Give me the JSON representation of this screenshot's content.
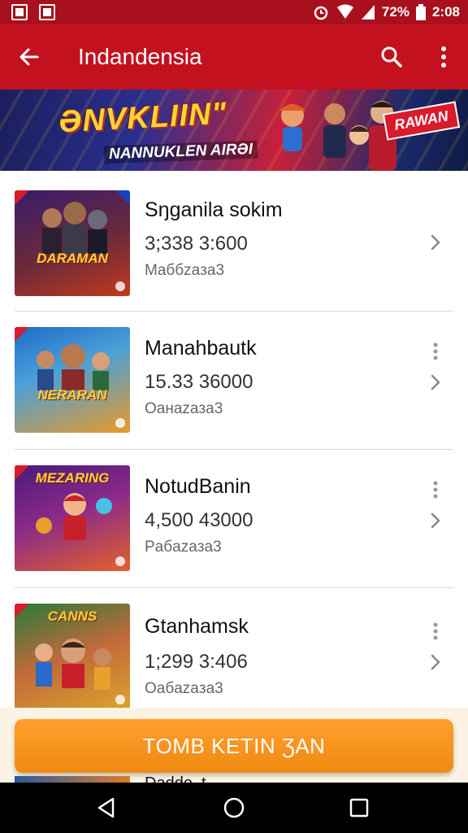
{
  "status_bar": {
    "battery_text": "72%",
    "time": "2:08",
    "icons": [
      "image-icon",
      "notification-icon",
      "alarm-icon",
      "wifi-icon",
      "signal-icon",
      "battery-icon"
    ]
  },
  "app_bar": {
    "title": "Indandensia",
    "back_icon": "arrow-left-icon",
    "search_icon": "search-icon",
    "menu_icon": "more-vert-icon",
    "color": "#c4111f"
  },
  "banner": {
    "title": "ƏNVKLIIN\"",
    "subtitle": "NANNUKLEN AIRƏI",
    "badge": "RAWAN"
  },
  "items": [
    {
      "title": "Sŋganila sokim",
      "numbers": "3;338  3:600",
      "subtitle": "Maббzaза3",
      "thumb_title": "DARAMAN",
      "thumb_colors": [
        "#3a1c6a",
        "#c23a1e"
      ],
      "kebab": false
    },
    {
      "title": "Manahbautk",
      "numbers": "15.33  36000",
      "subtitle": "Oaнazaза3",
      "thumb_title": "NERARAN",
      "thumb_colors": [
        "#1f6cc7",
        "#e79a2a"
      ],
      "kebab": true
    },
    {
      "title": "NotudBanin",
      "numbers": "4,500  43000",
      "subtitle": "Paбazaза3",
      "thumb_title": "MEZARING",
      "thumb_colors": [
        "#4a1a7a",
        "#e3612a"
      ],
      "kebab": true
    },
    {
      "title": "Gtanhamsk",
      "numbers": "1;299  3:406",
      "subtitle": "Oaбazaза3",
      "thumb_title": "CANNS",
      "thumb_colors": [
        "#2a7a3a",
        "#d9a32a"
      ],
      "kebab": true
    }
  ],
  "cta": {
    "label": "TOMB KETIN ƷAN",
    "color": "#f39116"
  },
  "peek_item": {
    "title": "Dadde..t.."
  },
  "nav": {
    "back_icon": "nav-back-icon",
    "home_icon": "nav-home-icon",
    "recents_icon": "nav-recents-icon"
  }
}
